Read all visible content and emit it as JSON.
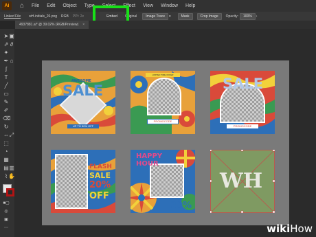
{
  "app": {
    "logo": "Ai"
  },
  "menu": [
    "File",
    "Edit",
    "Object",
    "Type",
    "Select",
    "Effect",
    "View",
    "Window",
    "Help"
  ],
  "controlbar": {
    "linked_file": "Linked File",
    "filename": "wH-initials_26.png",
    "color_mode": "RGB",
    "ppi": "PPI: 2x",
    "embed": "Embed",
    "edit_original": "Edit Original",
    "image_trace": "Image Trace",
    "mask": "Mask",
    "crop_image": "Crop Image",
    "opacity_label": "Opacity:",
    "opacity_value": "100%"
  },
  "document": {
    "tab": "4937881.ai* @ 39.02% (RGB/Preview)"
  },
  "cards": {
    "card1": {
      "small": "AWESOME",
      "big": "SALE",
      "pill": "UP TO 50% OFF"
    },
    "card2": {
      "top": "LIMITED TIME OFFER",
      "pill": "PROMOCODE"
    },
    "card3": {
      "big": "SALE",
      "pill": "PROMOCODE"
    },
    "card4": {
      "line1": "FLASH",
      "line2": "SALE",
      "line3": "20%",
      "line4": "OFF"
    },
    "card5": {
      "line1": "HAPPY",
      "line2": "HOUR",
      "pct": "20%"
    },
    "card6": {
      "letters": "WH"
    }
  },
  "watermark": {
    "wiki": "wiki",
    "how": "How"
  },
  "colors": {
    "highlight": "#18e018",
    "accent_orange": "#ff9a00"
  }
}
